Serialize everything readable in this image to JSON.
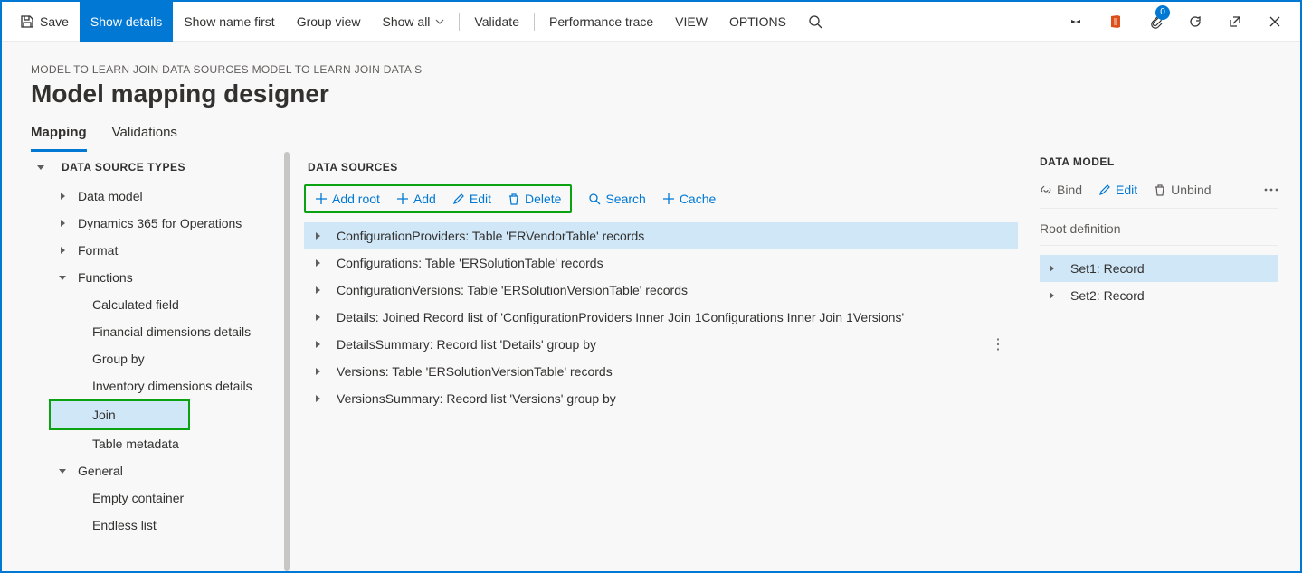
{
  "topbar": {
    "save": "Save",
    "show_details": "Show details",
    "show_name_first": "Show name first",
    "group_view": "Group view",
    "show_all": "Show all",
    "validate": "Validate",
    "perf_trace": "Performance trace",
    "view": "VIEW",
    "options": "OPTIONS",
    "badge_count": "0"
  },
  "page": {
    "breadcrumb": "MODEL TO LEARN JOIN DATA SOURCES MODEL TO LEARN JOIN DATA S",
    "title": "Model mapping designer"
  },
  "tabs": {
    "mapping": "Mapping",
    "validations": "Validations"
  },
  "left": {
    "header": "DATA SOURCE TYPES",
    "nodes": [
      {
        "label": "Data model",
        "indent": 1,
        "caret": "collapsed"
      },
      {
        "label": "Dynamics 365 for Operations",
        "indent": 1,
        "caret": "collapsed"
      },
      {
        "label": "Format",
        "indent": 1,
        "caret": "collapsed"
      },
      {
        "label": "Functions",
        "indent": 1,
        "caret": "expanded"
      },
      {
        "label": "Calculated field",
        "indent": 2,
        "caret": "none"
      },
      {
        "label": "Financial dimensions details",
        "indent": 2,
        "caret": "none"
      },
      {
        "label": "Group by",
        "indent": 2,
        "caret": "none"
      },
      {
        "label": "Inventory dimensions details",
        "indent": 2,
        "caret": "none"
      },
      {
        "label": "Join",
        "indent": 2,
        "caret": "none",
        "selected": true,
        "highlight": true
      },
      {
        "label": "Table metadata",
        "indent": 2,
        "caret": "none"
      },
      {
        "label": "General",
        "indent": 1,
        "caret": "expanded"
      },
      {
        "label": "Empty container",
        "indent": 2,
        "caret": "none"
      },
      {
        "label": "Endless list",
        "indent": 2,
        "caret": "none"
      }
    ]
  },
  "mid": {
    "header": "DATA SOURCES",
    "tools": {
      "add_root": "Add root",
      "add": "Add",
      "edit": "Edit",
      "delete": "Delete",
      "search": "Search",
      "cache": "Cache"
    },
    "rows": [
      {
        "label": "ConfigurationProviders: Table 'ERVendorTable' records",
        "selected": true
      },
      {
        "label": "Configurations: Table 'ERSolutionTable' records"
      },
      {
        "label": "ConfigurationVersions: Table 'ERSolutionVersionTable' records"
      },
      {
        "label": "Details: Joined Record list of 'ConfigurationProviders Inner Join 1Configurations Inner Join 1Versions'"
      },
      {
        "label": "DetailsSummary: Record list 'Details' group by",
        "more": true
      },
      {
        "label": "Versions: Table 'ERSolutionVersionTable' records"
      },
      {
        "label": "VersionsSummary: Record list 'Versions' group by"
      }
    ]
  },
  "right": {
    "header": "DATA MODEL",
    "tools": {
      "bind": "Bind",
      "edit": "Edit",
      "unbind": "Unbind"
    },
    "sub": "Root definition",
    "items": [
      {
        "label": "Set1: Record",
        "selected": true
      },
      {
        "label": "Set2: Record"
      }
    ]
  }
}
